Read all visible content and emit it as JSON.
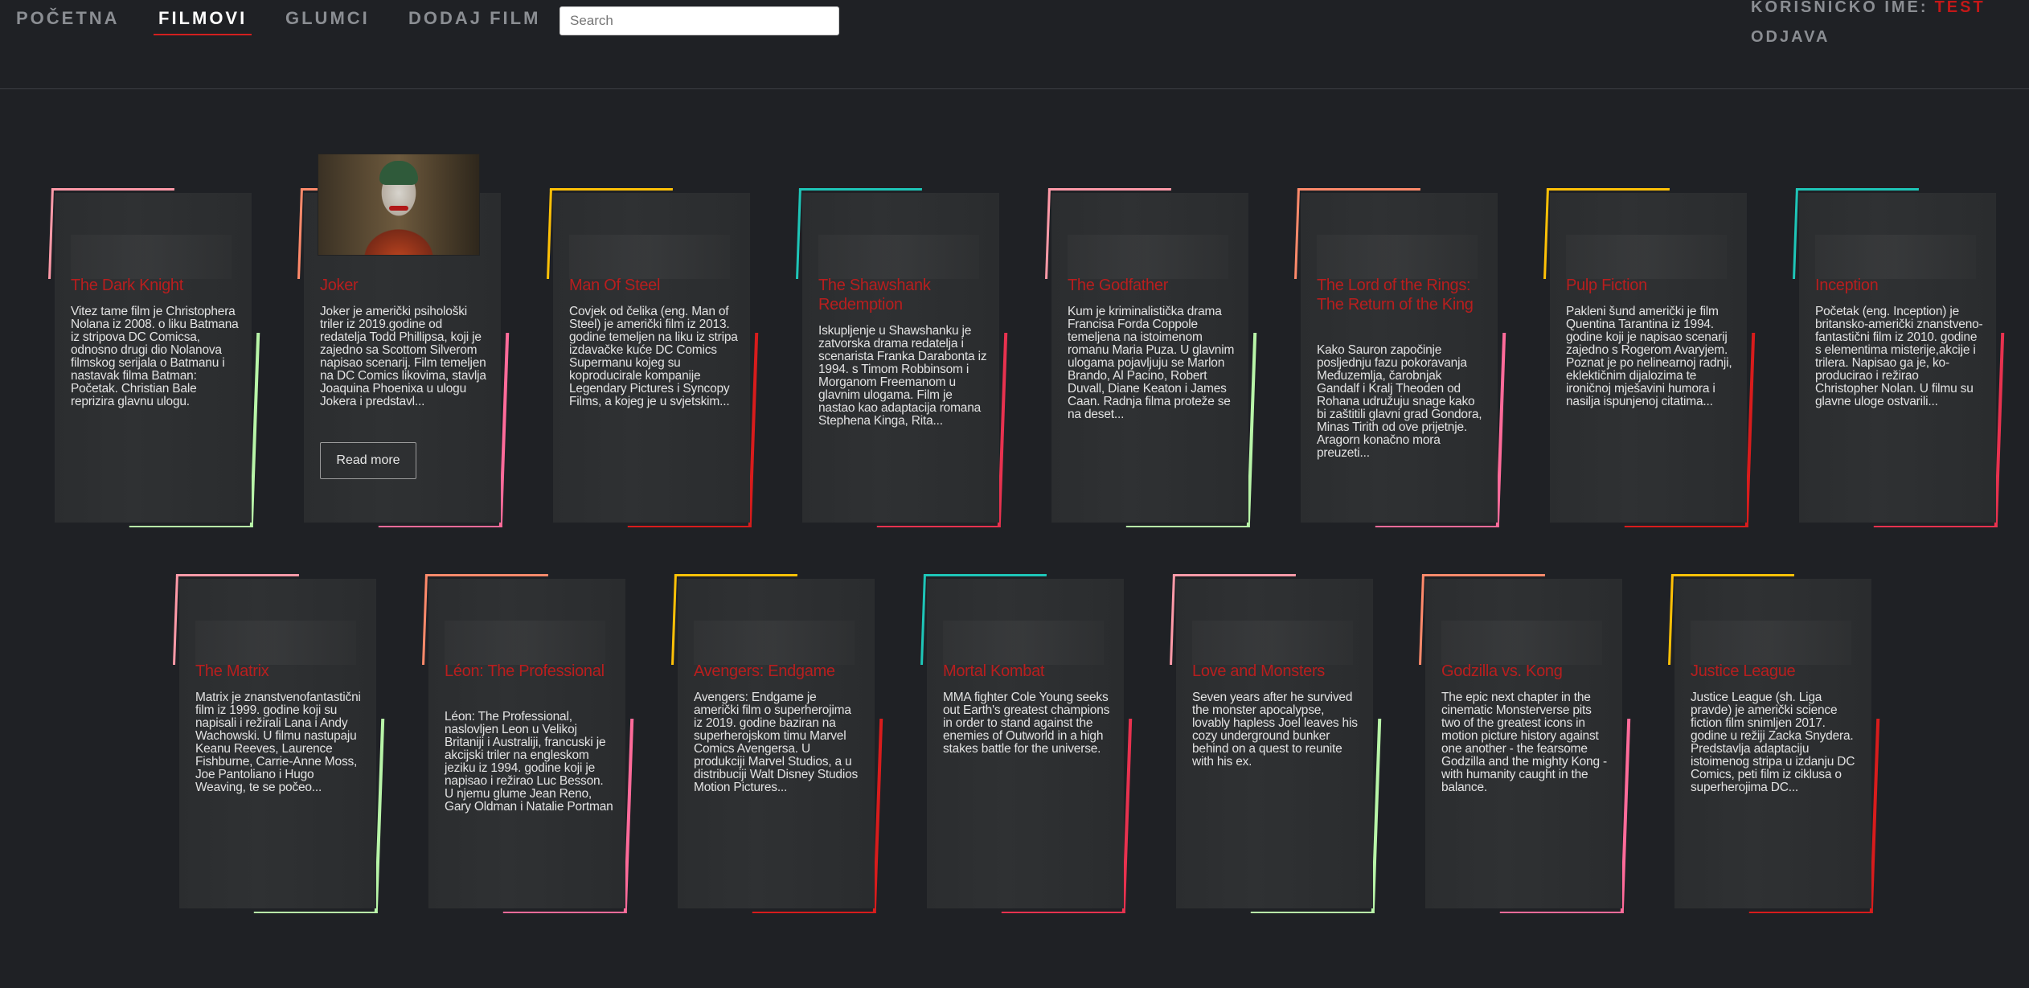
{
  "nav": {
    "items": [
      "Početna",
      "Filmovi",
      "Glumci",
      "Dodaj film"
    ],
    "active_index": 1,
    "search_placeholder": "Search",
    "user_label": "KORISNIČKO IME:",
    "user_name": "TEST",
    "logout": "ODJAVA"
  },
  "colors": {
    "background": "#1f2125",
    "accent_red": "#c31818",
    "card_accents": [
      "#ff9aa8",
      "#ff8a6b",
      "#ffc107",
      "#1ec6b8"
    ],
    "card_edges": [
      "#b8f5a8",
      "#ff6b9a",
      "#d81c1c",
      "#e8324f"
    ]
  },
  "movies": [
    {
      "title": "The Dark Knight",
      "description": "Vitez tame film je Christophera Nolana iz 2008. o liku Batmana iz stripova DC Comicsa, odnosno drugi dio Nolanova filmskog serijala o Batmanu i nastavak filma Batman: Početak. Christian Bale reprizira glavnu ulogu."
    },
    {
      "title": "Joker",
      "description": "Joker je američki psihološki triler iz 2019.godine od redatelja Todd Phillipsa, koji je zajedno sa Scottom Silverom napisao scenarij. Film temeljen na DC Comics likovima, stavlja Joaquina Phoenixa u ulogu Jokera i predstavl...",
      "button": "Read more",
      "image_icon": "joker-poster"
    },
    {
      "title": "Man Of Steel",
      "description": "Covjek od čelika (eng. Man of Steel) je američki film iz 2013. godine temeljen na liku iz stripa izdavačke kuće DC Comics Supermanu kojeg su koproducirale kompanije Legendary Pictures i Syncopy Films, a kojeg je u svjetskim..."
    },
    {
      "title": "The Shawshank Redemption",
      "description": "Iskupljenje u Shawshanku je zatvorska drama redatelja i scenarista Franka Darabonta iz 1994. s Timom Robbinsom i Morganom Freemanom u glavnim ulogama. Film je nastao kao adaptacija romana Stephena Kinga, Rita..."
    },
    {
      "title": "The Godfather",
      "description": "Kum je kriminalistička drama Francisa Forda Coppole temeljena na istoimenom romanu Maria Puza. U glavnim ulogama pojavljuju se Marlon Brando, Al Pacino, Robert Duvall, Diane Keaton i James Caan. Radnja filma proteže se na deset..."
    },
    {
      "title": "The Lord of the Rings: The Return of the King",
      "description": "Kako Sauron započinje posljednju fazu pokoravanja Međuzemlja, čarobnjak Gandalf i Kralj Theoden od Rohana udružuju snage kako bi zaštitili glavni grad Gondora, Minas Tirith od ove prijetnje. Aragorn konačno mora preuzeti..."
    },
    {
      "title": "Pulp Fiction",
      "description": "Pakleni šund američki je film Quentina Tarantina iz 1994. godine koji je napisao scenarij zajedno s Rogerom Avaryjem. Poznat je po nelinearnoj radnji, eklektičnim dijalozima te ironičnoj mješavini humora i nasilja ispunjenoj citatima..."
    },
    {
      "title": "Inception",
      "description": "Početak (eng. Inception) je britansko-američki znanstveno-fantastični film iz 2010. godine s elementima misterije,akcije i trilera. Napisao ga je, ko-producirao i režirao Christopher Nolan. U filmu su glavne uloge ostvarili..."
    },
    {
      "title": "The Matrix",
      "description": "Matrix je znanstvenofantastični film iz 1999. godine koji su napisali i režirali Lana i Andy Wachowski. U filmu nastupaju Keanu Reeves, Laurence Fishburne, Carrie-Anne Moss, Joe Pantoliano i Hugo Weaving, te se počeo..."
    },
    {
      "title": "Léon: The Professional",
      "description": "Léon: The Professional, naslovljen Leon u Velikoj Britaniji i Australiji, francuski je akcijski triler na engleskom jeziku iz 1994. godine koji je napisao i režirao Luc Besson. U njemu glume Jean Reno, Gary Oldman i Natalie Portman"
    },
    {
      "title": "Avengers: Endgame",
      "description": "Avengers: Endgame je američki film o superherojima iz 2019. godine baziran na superherojskom timu Marvel Comics Avengersa. U produkciji Marvel Studios, a u distribuciji Walt Disney Studios Motion Pictures..."
    },
    {
      "title": "Mortal Kombat",
      "description": "MMA fighter Cole Young seeks out Earth's greatest champions in order to stand against the enemies of Outworld in a high stakes battle for the universe."
    },
    {
      "title": "Love and Monsters",
      "description": "Seven years after he survived the monster apocalypse, lovably hapless Joel leaves his cozy underground bunker behind on a quest to reunite with his ex."
    },
    {
      "title": "Godzilla vs. Kong",
      "description": "The epic next chapter in the cinematic Monsterverse pits two of the greatest icons in motion picture history against one another - the fearsome Godzilla and the mighty Kong - with humanity caught in the balance."
    },
    {
      "title": "Justice League",
      "description": "Justice League (sh. Liga pravde) je američki science fiction film snimljen 2017. godine u režiji Zacka Snydera. Predstavlja adaptaciju istoimenog stripa u izdanju DC Comics, peti film iz ciklusa o superherojima DC..."
    }
  ]
}
